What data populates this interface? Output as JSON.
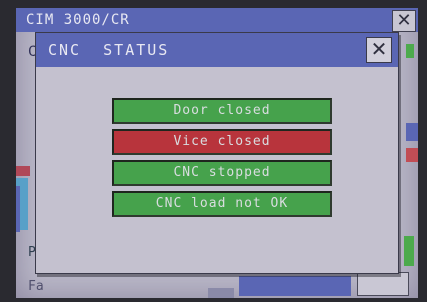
{
  "background_window": {
    "title": "CIM 3000/CR",
    "close_glyph": "✕",
    "left_letter": "C",
    "p_label": "P",
    "bottom_label": "Fa",
    "bottom_button_label": "",
    "bottom_button2_label": ""
  },
  "dialog": {
    "title": "CNC  STATUS",
    "close_glyph": "✕"
  },
  "status_items": [
    {
      "label": "Door closed",
      "color": "#46a24c"
    },
    {
      "label": "Vice closed",
      "color": "#b8343c"
    },
    {
      "label": "CNC stopped",
      "color": "#46a24c"
    },
    {
      "label": "CNC load not OK",
      "color": "#46a24c"
    }
  ],
  "colors": {
    "titlebar": "#5a66b4",
    "status_ok": "#46a24c",
    "status_alert": "#b8343c"
  }
}
